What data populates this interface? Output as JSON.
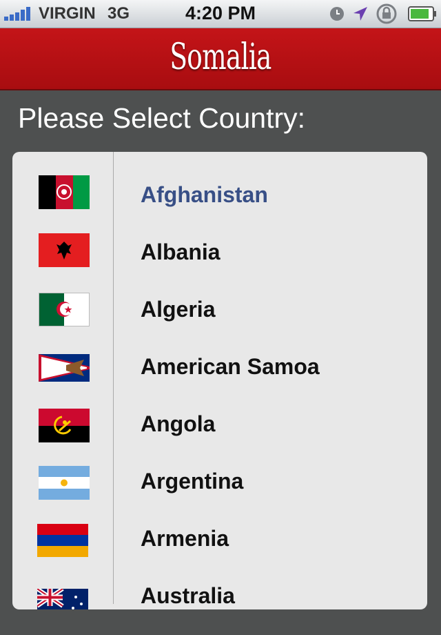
{
  "status_bar": {
    "carrier": "VIRGIN",
    "network": "3G",
    "time": "4:20 PM",
    "icons": [
      "signal-bars-icon",
      "clock-icon",
      "location-arrow-icon",
      "rotation-lock-icon",
      "battery-icon"
    ],
    "battery_level": 0.85
  },
  "header": {
    "title": "Somalia",
    "color": "#b71015"
  },
  "prompt": "Please Select Country:",
  "countries": [
    {
      "name": "Afghanistan",
      "flag": "afghanistan-flag-icon",
      "selected": true
    },
    {
      "name": "Albania",
      "flag": "albania-flag-icon"
    },
    {
      "name": "Algeria",
      "flag": "algeria-flag-icon"
    },
    {
      "name": "American Samoa",
      "flag": "american-samoa-flag-icon"
    },
    {
      "name": "Angola",
      "flag": "angola-flag-icon"
    },
    {
      "name": "Argentina",
      "flag": "argentina-flag-icon"
    },
    {
      "name": "Armenia",
      "flag": "armenia-flag-icon"
    },
    {
      "name": "Australia",
      "flag": "australia-flag-icon"
    }
  ],
  "colors": {
    "selected_text": "#384f86",
    "panel": "#e8e8e8",
    "background": "#4e5050"
  }
}
